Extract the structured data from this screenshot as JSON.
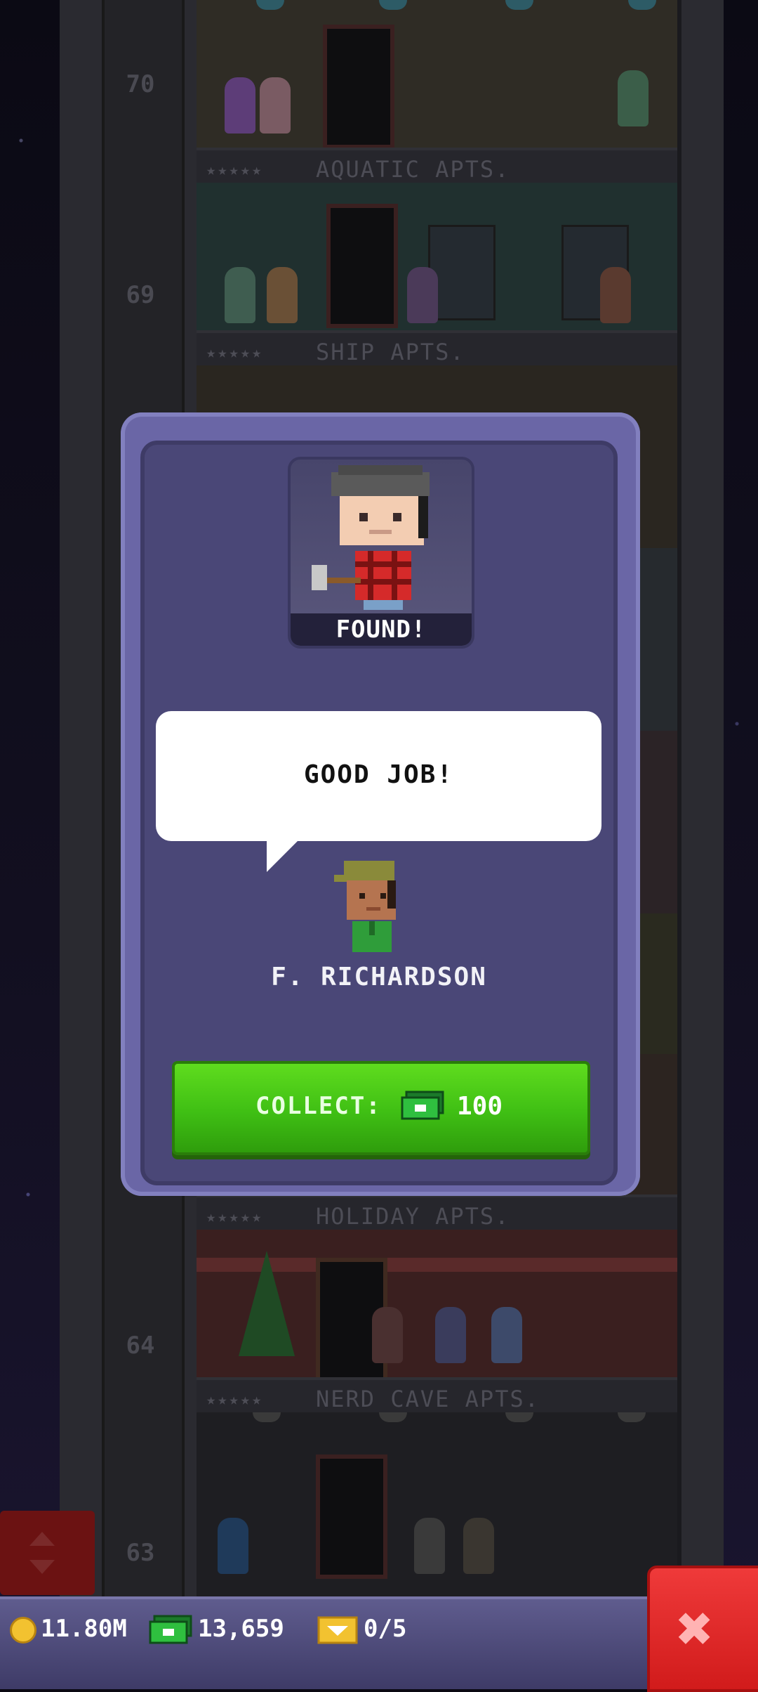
{
  "game": {
    "floors": [
      {
        "number": "70",
        "name": "AQUATIC APTS.",
        "stars": "★★★★★"
      },
      {
        "number": "69",
        "name": "SHIP APTS.",
        "stars": "★★★★★"
      },
      {
        "number": "",
        "name": "HOLIDAY APTS.",
        "stars": "★★★★★"
      },
      {
        "number": "64",
        "name": "NERD CAVE APTS.",
        "stars": "★★★★★"
      },
      {
        "number": "63",
        "name": "",
        "stars": ""
      }
    ]
  },
  "dialog": {
    "found_label": "FOUND!",
    "speech": "GOOD JOB!",
    "npc_name": "F. RICHARDSON",
    "collect_label": "COLLECT:",
    "collect_value": "100",
    "reward_icon": "bux-icon"
  },
  "hud": {
    "coins": "11.80M",
    "bux": "13,659",
    "tickets": "0/5",
    "coin_icon": "coin-icon",
    "bux_icon": "bux-icon",
    "ticket_icon": "ticket-icon",
    "close_icon": "close-icon"
  },
  "colors": {
    "dialog_bg": "#4a4777",
    "collect_green": "#3fbf14",
    "close_red": "#d11b1b",
    "coin_gold": "#f2c230"
  }
}
